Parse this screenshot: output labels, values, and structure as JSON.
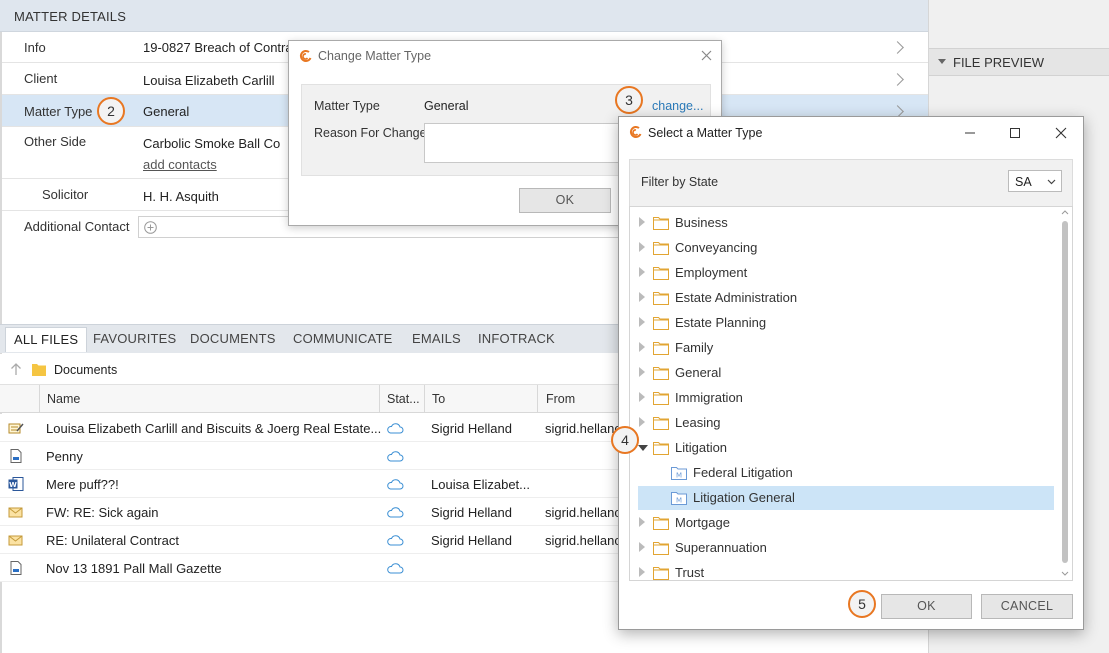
{
  "matter_details": {
    "header": "MATTER DETAILS",
    "rows": [
      {
        "label": "Info",
        "value": "19-0827 Breach of Contra"
      },
      {
        "label": "Client",
        "value": "Louisa Elizabeth Carlill"
      },
      {
        "label": "Matter Type",
        "value": "General"
      },
      {
        "label": "Other Side",
        "value": "Carbolic Smoke Ball Co",
        "link": "add contacts"
      },
      {
        "label": "Solicitor",
        "value": "H. H. Asquith"
      },
      {
        "label": "Additional Contact",
        "value": ""
      }
    ]
  },
  "right_panel": {
    "file_preview": "FILE PREVIEW"
  },
  "callouts": [
    "2",
    "3",
    "4",
    "5"
  ],
  "files": {
    "tabs": [
      "ALL FILES",
      "FAVOURITES",
      "DOCUMENTS",
      "COMMUNICATE",
      "EMAILS",
      "INFOTRACK"
    ],
    "path": "Documents",
    "columns": {
      "name": "Name",
      "status": "Stat...",
      "to": "To",
      "from": "From"
    },
    "rows": [
      {
        "icon": "note-icon",
        "name": "Louisa Elizabeth Carlill and Biscuits & Joerg Real Estate...",
        "to": "Sigrid Helland",
        "from": "sigrid.hellanc"
      },
      {
        "icon": "document-icon",
        "name": "Penny",
        "to": "",
        "from": ""
      },
      {
        "icon": "word-icon",
        "name": "Mere puff??!",
        "to": "Louisa Elizabet...",
        "from": ""
      },
      {
        "icon": "email-icon",
        "name": "FW: RE: Sick again",
        "to": "Sigrid Helland",
        "from": "sigrid.hellanc"
      },
      {
        "icon": "email-icon",
        "name": "RE: Unilateral Contract",
        "to": "Sigrid Helland",
        "from": "sigrid.hellanc"
      },
      {
        "icon": "document-icon",
        "name": "Nov 13 1891 Pall Mall Gazette",
        "to": "",
        "from": ""
      }
    ]
  },
  "change_dialog": {
    "title": "Change Matter Type",
    "matter_type_label": "Matter Type",
    "matter_type_value": "General",
    "change_link": "change...",
    "reason_label": "Reason For Change",
    "reason_value": "",
    "ok": "OK"
  },
  "select_dialog": {
    "title": "Select a Matter Type",
    "filter_label": "Filter by State",
    "state": "SA",
    "tree": [
      {
        "label": "Business"
      },
      {
        "label": "Conveyancing"
      },
      {
        "label": "Employment"
      },
      {
        "label": "Estate Administration"
      },
      {
        "label": "Estate Planning"
      },
      {
        "label": "Family"
      },
      {
        "label": "General"
      },
      {
        "label": "Immigration"
      },
      {
        "label": "Leasing"
      },
      {
        "label": "Litigation",
        "expanded": true,
        "children": [
          {
            "label": "Federal Litigation"
          },
          {
            "label": "Litigation General",
            "selected": true
          }
        ]
      },
      {
        "label": "Mortgage"
      },
      {
        "label": "Superannuation"
      },
      {
        "label": "Trust"
      }
    ],
    "ok": "OK",
    "cancel": "CANCEL"
  },
  "colors": {
    "accent": "#e87722",
    "link": "#2a7ab9",
    "selected": "#cce4f7",
    "folder": "#f2c66a"
  }
}
